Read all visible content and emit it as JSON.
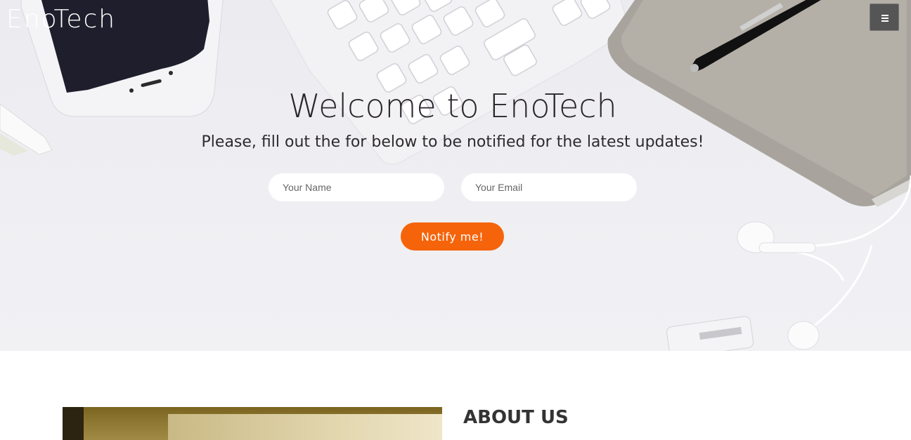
{
  "header": {
    "brand": "EnoTech",
    "menu_icon": "hamburger-menu-icon"
  },
  "hero": {
    "title": "Welcome to EnoTech",
    "subtitle": "Please, fill out the for below to be notified for the latest updates!",
    "form": {
      "name_placeholder": "Your Name",
      "name_value": "",
      "email_placeholder": "Your Email",
      "email_value": "",
      "submit_label": "Notify me!"
    }
  },
  "about": {
    "heading": "ABOUT US"
  },
  "colors": {
    "accent": "#f5640a",
    "menu_button": "#555555",
    "text_dark": "#2a2528"
  }
}
